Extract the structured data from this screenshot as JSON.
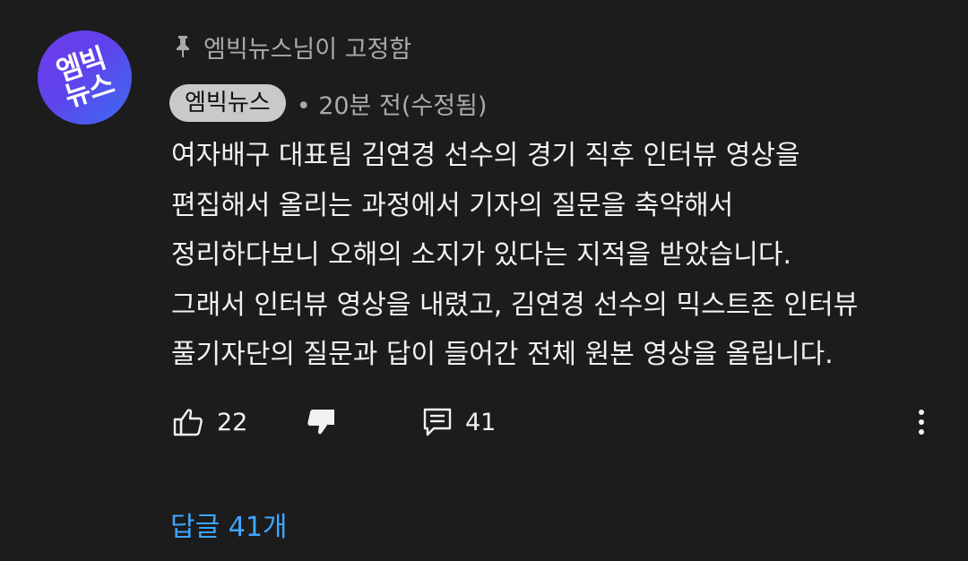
{
  "avatar": {
    "text": "엠빅\n뉴스",
    "gradient": [
      "#6f39e8",
      "#3c6cf0"
    ]
  },
  "pinned_label": "엠빅뉴스님이 고정함",
  "author": {
    "name": "엠빅뉴스",
    "meta": "• 20분 전(수정됨)"
  },
  "comment_lines": [
    "여자배구 대표팀 김연경 선수의 경기 직후 인터뷰 영상을",
    "편집해서 올리는 과정에서 기자의 질문을 축약해서",
    "정리하다보니 오해의 소지가 있다는 지적을 받았습니다.",
    "그래서 인터뷰 영상을 내렸고, 김연경 선수의 믹스트존 인터뷰",
    "풀기자단의 질문과 답이 들어간 전체 원본 영상을 올립니다."
  ],
  "actions": {
    "like_count": "22",
    "reply_count": "41"
  },
  "icons": [
    "pin-icon",
    "thumbs-up-icon",
    "thumbs-down-icon",
    "comment-icon",
    "more-vert-icon"
  ],
  "replies_link": "답글 41개",
  "colors": {
    "background": "#1c1c1c",
    "link": "#3ea6ff",
    "muted": "#aaaaaa",
    "chip": "#c9c9c9"
  }
}
